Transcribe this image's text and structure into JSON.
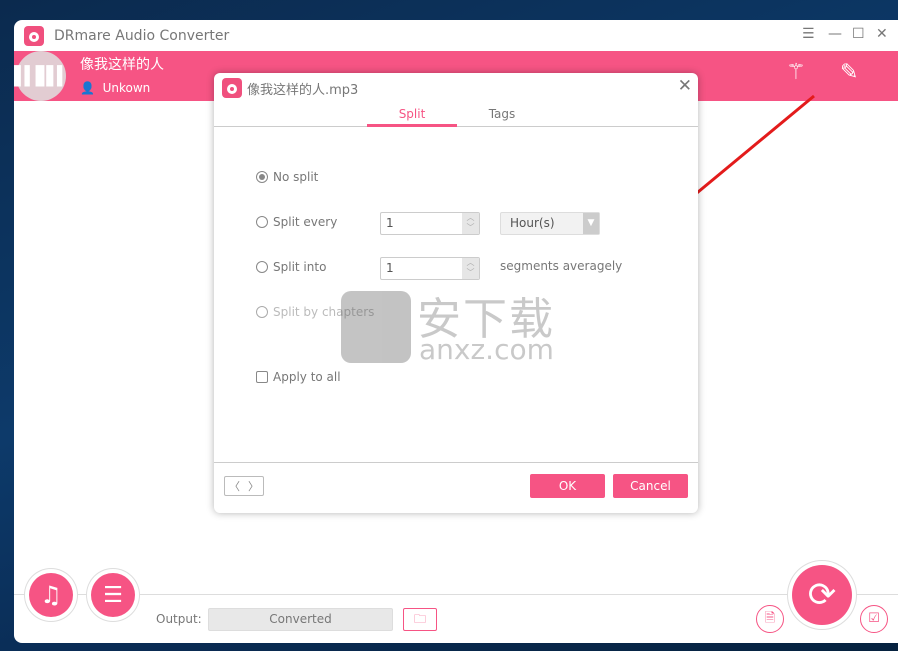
{
  "app": {
    "title": "DRmare Audio Converter",
    "accent": "#f65484"
  },
  "track": {
    "title": "像我这样的人",
    "artist": "Unkown"
  },
  "bottom": {
    "output_label": "Output:",
    "output_value": "Converted"
  },
  "dialog": {
    "title": "像我这样的人.mp3",
    "tabs": [
      {
        "label": "Split",
        "active": true
      },
      {
        "label": "Tags",
        "active": false
      }
    ],
    "options": {
      "no_split": "No split",
      "split_every": "Split every",
      "split_into": "Split into",
      "split_by_chapters": "Split by chapters",
      "apply_to_all": "Apply to all"
    },
    "selected": "No split",
    "split_every_value": "1",
    "unit": "Hour(s)",
    "split_into_value": "1",
    "segments_text": "segments averagely",
    "ok": "OK",
    "cancel": "Cancel"
  },
  "watermark": {
    "cn": "安下载",
    "en": "anxz.com"
  }
}
